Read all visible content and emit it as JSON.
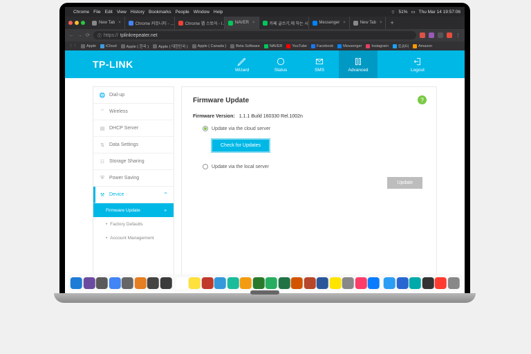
{
  "menubar": {
    "app": "Chrome",
    "items": [
      "File",
      "Edit",
      "View",
      "History",
      "Bookmarks",
      "People",
      "Window",
      "Help"
    ],
    "battery": "51%",
    "clock": "Thu Mar 14  19:57:06"
  },
  "tabs": [
    {
      "label": "New Tab",
      "fav": "#888"
    },
    {
      "label": "Chrome 커뮤니티 - …",
      "fav": "#4285f4"
    },
    {
      "label": "Chrome 웹 스토어 - l…",
      "fav": "#ea4335"
    },
    {
      "label": "NAVER",
      "fav": "#03c75a",
      "active": true
    },
    {
      "label": "카페 글쓰기,에 하는 시…",
      "fav": "#03c75a"
    },
    {
      "label": "Messenger",
      "fav": "#0084ff"
    },
    {
      "label": "New Tab",
      "fav": "#888"
    }
  ],
  "addressbar": {
    "url_prefix": "https://",
    "url_host": "tplinkrepeater.net"
  },
  "bookmarks": [
    {
      "label": "Apple",
      "color": "#666"
    },
    {
      "label": "iCloud",
      "color": "#3e9bde"
    },
    {
      "label": "Apple ( 한국 )",
      "color": "#666"
    },
    {
      "label": "Apple ( 대한민국 )",
      "color": "#666"
    },
    {
      "label": "Apple ( Canada )",
      "color": "#666"
    },
    {
      "label": "Beta Software",
      "color": "#666"
    },
    {
      "label": "NAVER",
      "color": "#03c75a"
    },
    {
      "label": "YouTube",
      "color": "#ff0000"
    },
    {
      "label": "Facebook",
      "color": "#1877f2"
    },
    {
      "label": "Messenger",
      "color": "#0084ff"
    },
    {
      "label": "Instagram",
      "color": "#e4405f"
    },
    {
      "label": "트위터",
      "color": "#1da1f2"
    },
    {
      "label": "Amazon",
      "color": "#ff9900"
    }
  ],
  "tplink": {
    "logo": "TP-LINK",
    "nav": {
      "wizard": "Wizard",
      "status": "Status",
      "sms": "SMS",
      "advanced": "Advanced",
      "logout": "Logout"
    },
    "sidebar": {
      "dialup": "Dial-up",
      "wireless": "Wireless",
      "dhcp": "DHCP Server",
      "datasettings": "Data Settings",
      "storage": "Storage Sharing",
      "power": "Power Saving",
      "device": "Device",
      "sub_firmware": "Firmware Update",
      "sub_factory": "Factory Defaults",
      "sub_account": "Account Management"
    },
    "main": {
      "title": "Firmware Update",
      "fv_label": "Firmware Version:",
      "fv_value": "1.1.1 Build 160330 Rel.1002n",
      "opt_cloud": "Update via the cloud server",
      "check_btn": "Check for Updates",
      "opt_local": "Update via the local server",
      "update_btn": "Update",
      "help": "?"
    }
  },
  "dock_colors": [
    "#1e7cd6",
    "#6b4ba0",
    "#5a5a5a",
    "#4285f4",
    "#666",
    "#e67e22",
    "#444",
    "#3b3b3b",
    "#fff",
    "#fee13c",
    "#c0392b",
    "#3498db",
    "#1abc9c",
    "#f39c12",
    "#2b7a2b",
    "#27ae60",
    "#217346",
    "#d35400",
    "#b7472a",
    "#2b579a",
    "#fee500",
    "#888",
    "#fc3d6a",
    "#0a7cff",
    "#2a9df4",
    "#2a66d1",
    "#0aa",
    "#333",
    "#ff3b30",
    "#888"
  ]
}
